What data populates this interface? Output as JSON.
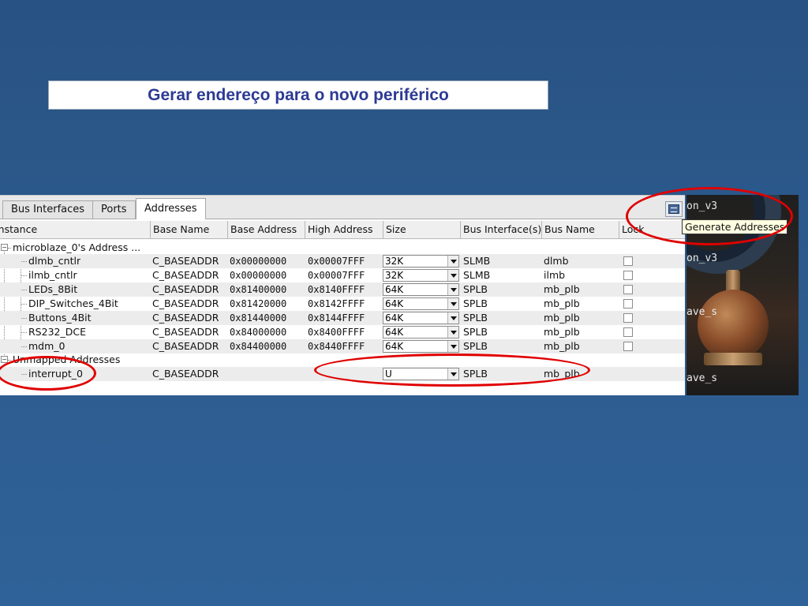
{
  "slide": {
    "title": "Gerar endereço para o novo periférico",
    "accent_color": "#e00000"
  },
  "tabs": [
    {
      "label": "Bus Interfaces",
      "active": false
    },
    {
      "label": "Ports",
      "active": false
    },
    {
      "label": "Addresses",
      "active": true
    }
  ],
  "toolbar": {
    "generate_icon": "generate-addresses-icon",
    "tooltip": "Generate Addresses"
  },
  "columns": [
    "Instance",
    "Base Name",
    "Base Address",
    "High Address",
    "Size",
    "Bus Interface(s)",
    "Bus Name",
    "Lock"
  ],
  "groups": [
    {
      "label": "microblaze_0's Address ...",
      "rows": [
        {
          "instance": "dlmb_cntlr",
          "base_name": "C_BASEADDR",
          "base_address": "0x00000000",
          "high_address": "0x00007FFF",
          "size": "32K",
          "bus_interface": "SLMB",
          "bus_name": "dlmb"
        },
        {
          "instance": "ilmb_cntlr",
          "base_name": "C_BASEADDR",
          "base_address": "0x00000000",
          "high_address": "0x00007FFF",
          "size": "32K",
          "bus_interface": "SLMB",
          "bus_name": "ilmb"
        },
        {
          "instance": "LEDs_8Bit",
          "base_name": "C_BASEADDR",
          "base_address": "0x81400000",
          "high_address": "0x8140FFFF",
          "size": "64K",
          "bus_interface": "SPLB",
          "bus_name": "mb_plb"
        },
        {
          "instance": "DIP_Switches_4Bit",
          "base_name": "C_BASEADDR",
          "base_address": "0x81420000",
          "high_address": "0x8142FFFF",
          "size": "64K",
          "bus_interface": "SPLB",
          "bus_name": "mb_plb"
        },
        {
          "instance": "Buttons_4Bit",
          "base_name": "C_BASEADDR",
          "base_address": "0x81440000",
          "high_address": "0x8144FFFF",
          "size": "64K",
          "bus_interface": "SPLB",
          "bus_name": "mb_plb"
        },
        {
          "instance": "RS232_DCE",
          "base_name": "C_BASEADDR",
          "base_address": "0x84000000",
          "high_address": "0x8400FFFF",
          "size": "64K",
          "bus_interface": "SPLB",
          "bus_name": "mb_plb"
        },
        {
          "instance": "mdm_0",
          "base_name": "C_BASEADDR",
          "base_address": "0x84400000",
          "high_address": "0x8440FFFF",
          "size": "64K",
          "bus_interface": "SPLB",
          "bus_name": "mb_plb"
        }
      ]
    },
    {
      "label": "Unmapped Addresses",
      "rows": [
        {
          "instance": "interrupt_0",
          "base_name": "C_BASEADDR",
          "base_address": "",
          "high_address": "",
          "size": "U",
          "bus_interface": "SPLB",
          "bus_name": "mb_plb"
        }
      ]
    }
  ],
  "side_panel": {
    "texts": [
      "on_v3",
      "on_v3",
      "ave_s",
      "ave_s"
    ]
  }
}
